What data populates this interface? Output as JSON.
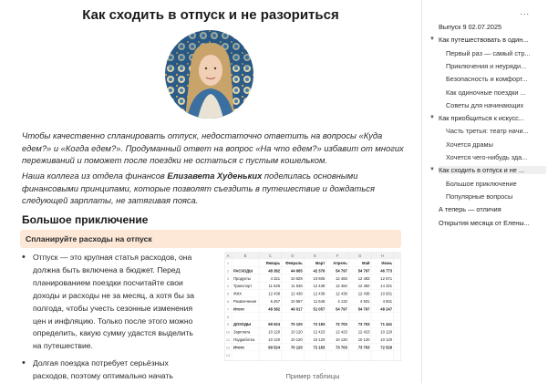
{
  "article": {
    "title": "Как сходить в отпуск и не разориться",
    "intro_p1": "Чтобы качественно спланировать отпуск, недостаточно ответить на вопросы «Куда едем?» и «Когда едем?». Продуманный ответ на вопрос «На что едем?» избавит от многих переживаний и поможет после поездки не остаться с пустым кошельком.",
    "intro_p2_before": "Наша коллега из отдела финансов ",
    "intro_p2_name": "Елизавета Худеньких",
    "intro_p2_after": " поделилась основными финансовыми принципами, которые позволят съездить в путешествие и дождаться следующей зарплаты, не затягивая пояса.",
    "section_heading": "Большое приключение",
    "callout": "Спланируйте расходы на отпуск",
    "bullets": [
      "Отпуск — это крупная статья расходов, она должна быть включена в бюджет. Перед планированием поездки посчитайте свои доходы и расходы не за месяц, а хотя бы за полгода, чтобы учесть сезонные изменения цен и инфляцию. Только после этого можно определить, какую сумму удастся выделить на путешествие.",
      "Долгая поездка потребует серьёзных расходов, поэтому оптимально начать откладывать за полгода. Так можно покрыть"
    ],
    "image_caption": "Пример таблицы"
  },
  "spreadsheet": {
    "col_letters": [
      "A",
      "B",
      "C",
      "D",
      "E",
      "F",
      "G",
      "H"
    ],
    "row_numbers": [
      "1",
      "2",
      "3",
      "4",
      "5",
      "6",
      "7",
      "8",
      "9",
      "10",
      "11",
      "12",
      "13"
    ],
    "headers": [
      "Январь",
      "Февраль",
      "Март",
      "Апрель",
      "Май",
      "Июнь"
    ],
    "rows": [
      {
        "label": "РАСХОДЫ",
        "bold": true,
        "values": [
          "48 382",
          "44 665",
          "42 376",
          "54 797",
          "54 797",
          "46 773"
        ]
      },
      {
        "label": "Продукты",
        "bold": false,
        "values": [
          "4 321",
          "10 629",
          "10 605",
          "12 483",
          "12 483",
          "12 571"
        ]
      },
      {
        "label": "Транспорт",
        "bold": false,
        "values": [
          "11 546",
          "11 546",
          "12 438",
          "12 482",
          "12 482",
          "14 321"
        ]
      },
      {
        "label": "ЖКХ",
        "bold": false,
        "values": [
          "12 438",
          "12 438",
          "12 438",
          "12 438",
          "12 438",
          "10 931"
        ]
      },
      {
        "label": "Развлечения",
        "bold": false,
        "values": [
          "6 457",
          "10 567",
          "11 546",
          "4 132",
          "4 931",
          "4 931"
        ]
      },
      {
        "label": "Итого",
        "bold": true,
        "values": [
          "48 382",
          "49 017",
          "51 057",
          "54 797",
          "54 797",
          "48 247"
        ]
      },
      {
        "label": "",
        "bold": false,
        "values": [
          "",
          "",
          "",
          "",
          "",
          ""
        ]
      },
      {
        "label": "ДОХОДЫ",
        "bold": true,
        "values": [
          "69 524",
          "70 120",
          "72 183",
          "72 703",
          "73 703",
          "71 441"
        ]
      },
      {
        "label": "Зарплата",
        "bold": false,
        "values": [
          "10 120",
          "10 120",
          "12 423",
          "12 423",
          "12 423",
          "10 120"
        ]
      },
      {
        "label": "Подработка",
        "bold": false,
        "values": [
          "10 120",
          "10 120",
          "10 120",
          "10 120",
          "10 120",
          "10 120"
        ]
      },
      {
        "label": "Итого",
        "bold": true,
        "values": [
          "69 524",
          "70 120",
          "72 183",
          "73 703",
          "73 703",
          "72 529"
        ]
      }
    ]
  },
  "toc": {
    "menu_dots": "...",
    "items": [
      {
        "text": "Выпуск 9 02.07.2025",
        "level": 0,
        "caret": "",
        "bold": false,
        "active": false
      },
      {
        "text": "Как путешествовать в один...",
        "level": 0,
        "caret": "▼",
        "bold": false,
        "active": false
      },
      {
        "text": "Первый раз — самый стр...",
        "level": 1,
        "caret": "",
        "bold": false,
        "active": false
      },
      {
        "text": "Приключения и неуряди...",
        "level": 1,
        "caret": "",
        "bold": false,
        "active": false
      },
      {
        "text": "Безопасность и комфорт...",
        "level": 1,
        "caret": "",
        "bold": false,
        "active": false
      },
      {
        "text": "Как одиночные поездки ...",
        "level": 1,
        "caret": "",
        "bold": false,
        "active": false
      },
      {
        "text": "Советы для начинающих",
        "level": 1,
        "caret": "",
        "bold": false,
        "active": false
      },
      {
        "text": "Как приобщиться к искусс...",
        "level": 0,
        "caret": "▼",
        "bold": false,
        "active": false
      },
      {
        "text": "Часть третья: театр начи...",
        "level": 1,
        "caret": "",
        "bold": false,
        "active": false
      },
      {
        "text": "Хочется драмы",
        "level": 1,
        "caret": "",
        "bold": false,
        "active": false
      },
      {
        "text": "Хочется чего-нибудь зда...",
        "level": 1,
        "caret": "",
        "bold": false,
        "active": false
      },
      {
        "text": "Как сходить в отпуск и не ...",
        "level": 0,
        "caret": "▼",
        "bold": false,
        "active": true
      },
      {
        "text": "Большое приключение",
        "level": 1,
        "caret": "",
        "bold": false,
        "active": false
      },
      {
        "text": "Популярные вопросы",
        "level": 1,
        "caret": "",
        "bold": false,
        "active": false
      },
      {
        "text": "А теперь — отличия",
        "level": 0,
        "caret": "",
        "bold": false,
        "active": false
      },
      {
        "text": "Открытия месяца от Елены...",
        "level": 0,
        "caret": "",
        "bold": false,
        "active": false
      }
    ]
  },
  "colors": {
    "callout_bg": "#fde7d6",
    "active_toc_bg": "#efefef"
  }
}
